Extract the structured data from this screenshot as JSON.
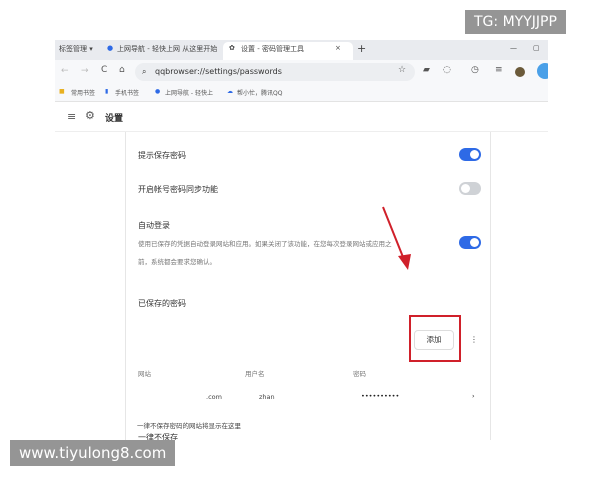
{
  "watermarks": {
    "top_right": "TG: MYYJJPP",
    "bottom_left": "www.tiyulong8.com"
  },
  "browser": {
    "tabs": [
      {
        "label": "标签管理 ▾"
      },
      {
        "label": "上网导航 - 轻快上网 从这里开始"
      },
      {
        "label": "设置 - 密码管理工具",
        "active": true
      }
    ],
    "new_tab": "+",
    "close": "×",
    "address": "qqbrowser://settings/passwords",
    "bookmarks": [
      "常用书签",
      "手机书签",
      "上网导航 - 轻快上",
      "帮小忙，腾讯QQ"
    ]
  },
  "header": {
    "title": "设置"
  },
  "settings": {
    "offer_save": {
      "label": "提示保存密码",
      "enabled": true
    },
    "sync": {
      "label": "开启帐号密码同步功能",
      "enabled": false
    },
    "auto_login": {
      "label": "自动登录",
      "desc1": "使用已保存的凭据自动登录网站和应用。如果关闭了该功能，在您每次登录网站或应用之",
      "desc2": "前，系统都会要求您确认。",
      "enabled": true
    },
    "saved": {
      "title": "已保存的密码",
      "add_label": "添加",
      "columns": [
        "网站",
        "用户名",
        "密码"
      ],
      "rows": [
        {
          "site": ".com",
          "user": "zhan",
          "password": "••••••••••"
        }
      ]
    },
    "never": {
      "title": "一律不保存",
      "empty": "一律不保存密码的网站将显示在这里"
    }
  },
  "colors": {
    "accent": "#2e6ae6",
    "highlight": "#d0202a"
  }
}
